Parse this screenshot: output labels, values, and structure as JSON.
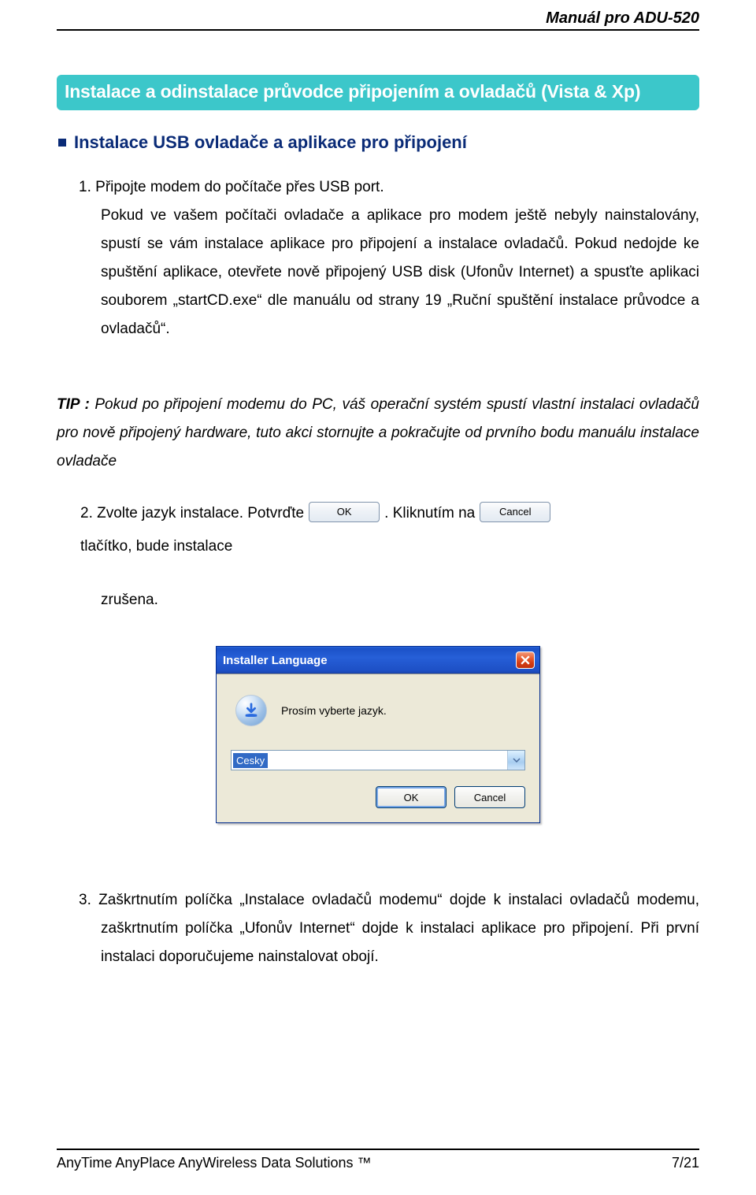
{
  "header": {
    "title": "Manuál pro ADU-520"
  },
  "section": {
    "banner": "Instalace a odinstalace průvodce připojením a ovladačů (Vista & Xp)",
    "subhead": "Instalace USB ovladače a aplikace pro připojení"
  },
  "step1": {
    "number": "1.",
    "text": "Připojte modem do počítače přes USB port.",
    "para": "Pokud ve vašem počítači ovladače a aplikace pro modem ještě nebyly nainstalovány, spustí se vám instalace aplikace pro připojení a instalace ovladačů. Pokud nedojde ke spuštění aplikace, otevřete nově připojený USB disk (Ufonův Internet) a spusťte aplikaci souborem „startCD.exe“ dle manuálu od strany 19 „Ruční spuštění instalace průvodce a ovladačů“."
  },
  "tip": {
    "label": "TIP :",
    "text": "Pokud po připojení modemu do PC, váš operační systém spustí vlastní instalaci ovladačů pro nově připojený hardware, tuto akci stornujte a pokračujte od prvního bodu manuálu instalace ovladače"
  },
  "step2": {
    "prefix": "2. Zvolte jazyk instalace. Potvrďte",
    "mid": ". Kliknutím na",
    "suffix": "tlačítko, bude instalace",
    "zrusena": "zrušena.",
    "ok_label": "OK",
    "cancel_label": "Cancel"
  },
  "dialog": {
    "title": "Installer Language",
    "prompt": "Prosím vyberte jazyk.",
    "selected": "Cesky",
    "ok": "OK",
    "cancel": "Cancel"
  },
  "step3": {
    "number": "3.",
    "text": "Zaškrtnutím políčka „Instalace ovladačů modemu“ dojde k instalaci ovladačů modemu, zaškrtnutím políčka „Ufonův Internet“ dojde k instalaci aplikace pro připojení. Při první instalaci doporučujeme nainstalovat obojí."
  },
  "footer": {
    "left": "AnyTime AnyPlace AnyWireless Data Solutions ™",
    "right": "7/21"
  }
}
